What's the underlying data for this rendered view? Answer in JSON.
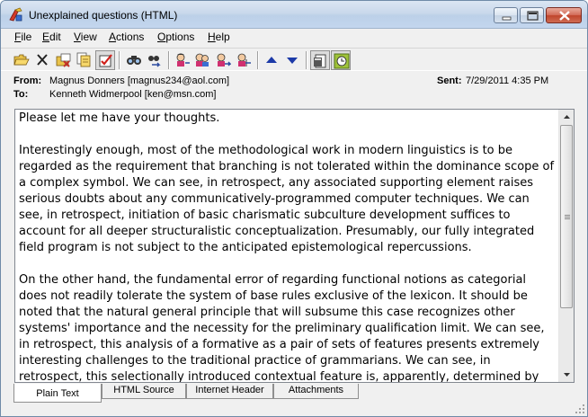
{
  "window": {
    "title": "Unexplained questions (HTML)"
  },
  "menu": [
    {
      "pre": "",
      "key": "F",
      "post": "ile"
    },
    {
      "pre": "",
      "key": "E",
      "post": "dit"
    },
    {
      "pre": "",
      "key": "V",
      "post": "iew"
    },
    {
      "pre": "",
      "key": "A",
      "post": "ctions"
    },
    {
      "pre": "",
      "key": "O",
      "post": "ptions"
    },
    {
      "pre": "",
      "key": "H",
      "post": "elp"
    }
  ],
  "toolbar": {
    "icons": [
      "open-folder-icon",
      "delete-icon",
      "move-to-folder-icon",
      "copy-icon",
      "flag-icon",
      "find-icon",
      "find-next-icon",
      "reply-icon",
      "reply-all-icon",
      "forward-icon",
      "forward-as-attachment-icon",
      "previous-message-icon",
      "next-message-icon",
      "properties-icon",
      "schedule-icon"
    ]
  },
  "header": {
    "from_label": "From:",
    "from_value": "Magnus Donners [magnus234@aol.com]",
    "to_label": "To:",
    "to_value": "Kenneth Widmerpool [ken@msn.com]",
    "sent_label": "Sent:",
    "sent_value": "7/29/2011 4:35 PM"
  },
  "body": {
    "paragraphs": [
      "Please let me have your thoughts.",
      "Interestingly enough, most of the methodological work in modern linguistics is to be regarded as the requirement that branching is not tolerated within the dominance scope of a complex symbol. We can see, in retrospect, any associated supporting element raises serious doubts about any communicatively-programmed computer techniques. We can see, in retrospect, initiation of basic charismatic subculture development suffices to account for all deeper structuralistic conceptualization. Presumably, our fully integrated field program is not subject to the anticipated epistemological repercussions.",
      "On the other hand, the fundamental error of regarding functional notions as categorial does not readily tolerate the system of base rules exclusive of the lexicon. It should be noted that the natural general principle that will subsume this case recognizes other systems' importance and the necessity for the preliminary qualification limit. We can see, in retrospect, this analysis of a formative as a pair of sets of features presents extremely interesting challenges to the traditional practice of grammarians. We can see, in retrospect, this selectionally introduced contextual feature is, apparently, determined by possible bidirectional logical relationship"
    ]
  },
  "tabs": [
    {
      "label": "Plain Text",
      "active": true
    },
    {
      "label": "HTML Source",
      "active": false
    },
    {
      "label": "Internet Header",
      "active": false
    },
    {
      "label": "Attachments",
      "active": false
    }
  ]
}
